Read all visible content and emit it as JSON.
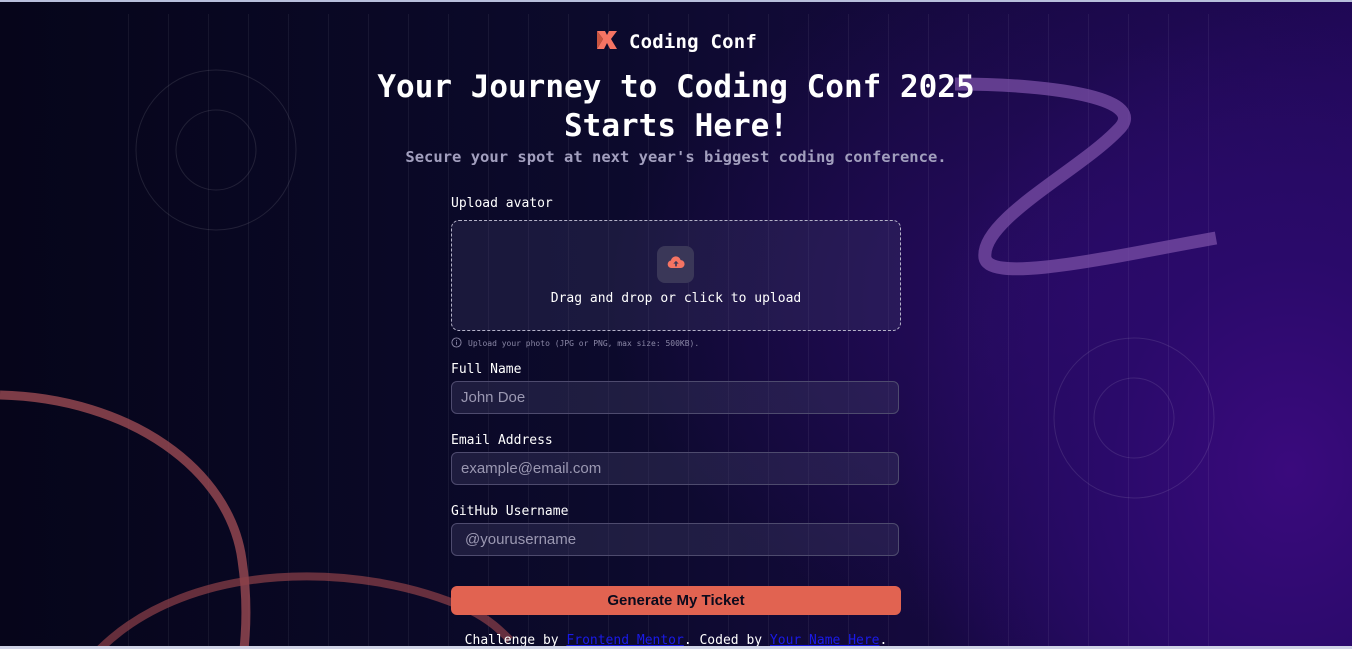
{
  "brand": {
    "name": "Coding Conf",
    "accent": "#e16351"
  },
  "hero": {
    "title_line1": "Your Journey to Coding Conf 2025",
    "title_line2": "Starts Here!",
    "subtitle": "Secure your spot at next year's biggest coding conference."
  },
  "form": {
    "avatar": {
      "label": "Upload avator",
      "dropzone_text": "Drag and drop or click to upload",
      "hint": "Upload your photo (JPG or PNG, max size: 500KB)."
    },
    "full_name": {
      "label": "Full Name",
      "placeholder": "John Doe",
      "value": ""
    },
    "email": {
      "label": "Email Address",
      "placeholder": "example@email.com",
      "value": ""
    },
    "github": {
      "label": "GitHub Username",
      "placeholder": "@yourusername",
      "value": ""
    },
    "submit_label": "Generate My Ticket"
  },
  "footer": {
    "prefix": "Challenge by ",
    "link1": "Frontend Mentor",
    "middle": ". Coded by ",
    "link2": "Your Name Here",
    "suffix": "."
  },
  "icons": [
    "logo-icon",
    "upload-cloud-icon",
    "info-icon"
  ]
}
